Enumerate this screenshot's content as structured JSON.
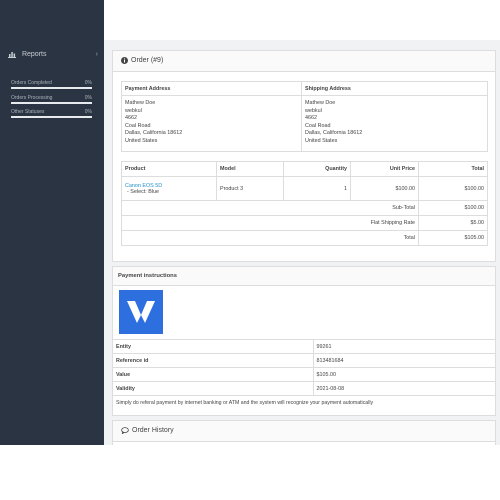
{
  "sidebar": {
    "reports_label": "Reports",
    "stats": [
      {
        "label": "Orders Completed",
        "value": "0%"
      },
      {
        "label": "Orders Processing",
        "value": "0%"
      },
      {
        "label": "Other Statuses",
        "value": "0%"
      }
    ]
  },
  "order": {
    "title": "Order (#9)",
    "address_headers": {
      "payment": "Payment Address",
      "shipping": "Shipping Address"
    },
    "payment_address": [
      "Mathew Doe",
      "webkul",
      "4662",
      "Coal Road",
      "Dallas, California 18612",
      "United States"
    ],
    "shipping_address": [
      "Mathew Doe",
      "webkul",
      "4662",
      "Coal Road",
      "Dallas, California 18612",
      "United States"
    ],
    "product_headers": {
      "product": "Product",
      "model": "Model",
      "quantity": "Quantity",
      "unit_price": "Unit Price",
      "total": "Total"
    },
    "product": {
      "name": "Canon EOS 5D",
      "option": "- Select: Blue",
      "model": "Product 3",
      "quantity": "1",
      "unit_price": "$100.00",
      "total": "$100.00"
    },
    "totals": [
      {
        "label": "Sub-Total",
        "value": "$100.00"
      },
      {
        "label": "Flat Shipping Rate",
        "value": "$5.00"
      },
      {
        "label": "Total",
        "value": "$105.00"
      }
    ]
  },
  "payment": {
    "title": "Payment instructions",
    "rows": [
      {
        "label": "Entity",
        "value": "99261"
      },
      {
        "label": "Reference id",
        "value": "813481684"
      },
      {
        "label": "Value",
        "value": "$105.00"
      },
      {
        "label": "Validity",
        "value": "2021-08-08"
      }
    ],
    "note": "Simply do referal payment by internet banking or ATM and the system will recognize your payment automatically"
  },
  "history": {
    "title": "Order History"
  },
  "colors": {
    "sidebar": "#2b3442",
    "link": "#1e91cf",
    "logo": "#2e6fe0"
  }
}
